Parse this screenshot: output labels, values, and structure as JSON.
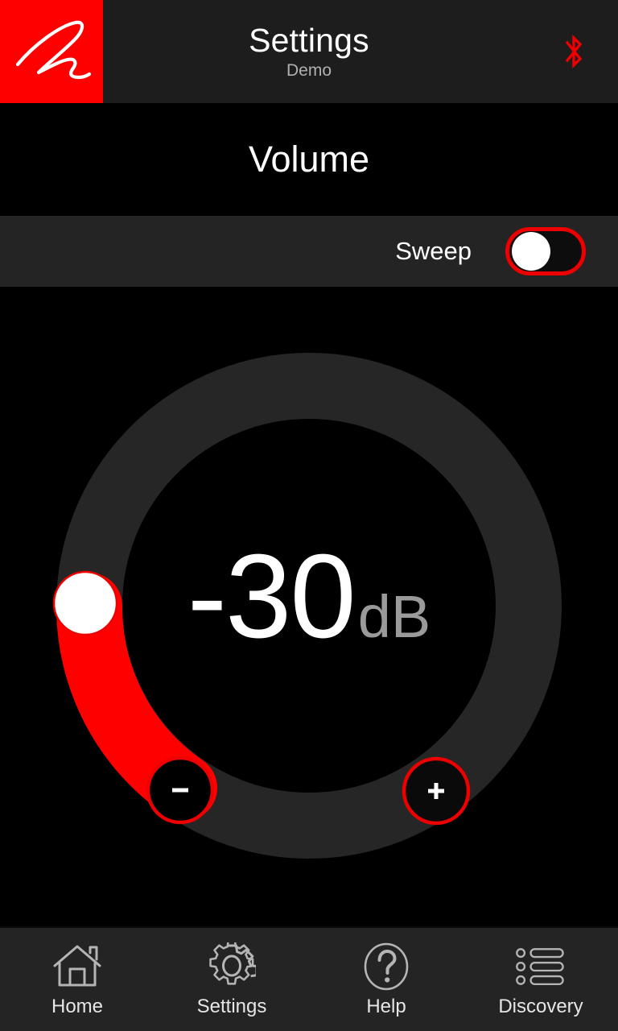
{
  "header": {
    "title": "Settings",
    "subtitle": "Demo",
    "brand_logo": "mcintosh-signature-logo",
    "bluetooth_icon": "bluetooth-icon",
    "brand_color": "#ff0000",
    "bar_color": "#1d1d1d"
  },
  "page": {
    "title": "Volume"
  },
  "sweep": {
    "label": "Sweep",
    "state": "off",
    "accent_color": "#ee0000"
  },
  "dial": {
    "value": "-30",
    "unit": "dB",
    "value_number": -30,
    "minimum": -80,
    "maximum": 0,
    "arc_color": "#ff0000",
    "track_color": "#262626",
    "knob_color": "#ffffff",
    "decrease_label": "-",
    "increase_label": "+",
    "decrease_name": "volume-decrease-button",
    "increase_name": "volume-increase-button"
  },
  "nav": {
    "items": [
      {
        "label": "Home",
        "icon": "home-icon"
      },
      {
        "label": "Settings",
        "icon": "gear-icon"
      },
      {
        "label": "Help",
        "icon": "question-mark-circle-icon"
      },
      {
        "label": "Discovery",
        "icon": "list-icon"
      }
    ]
  }
}
